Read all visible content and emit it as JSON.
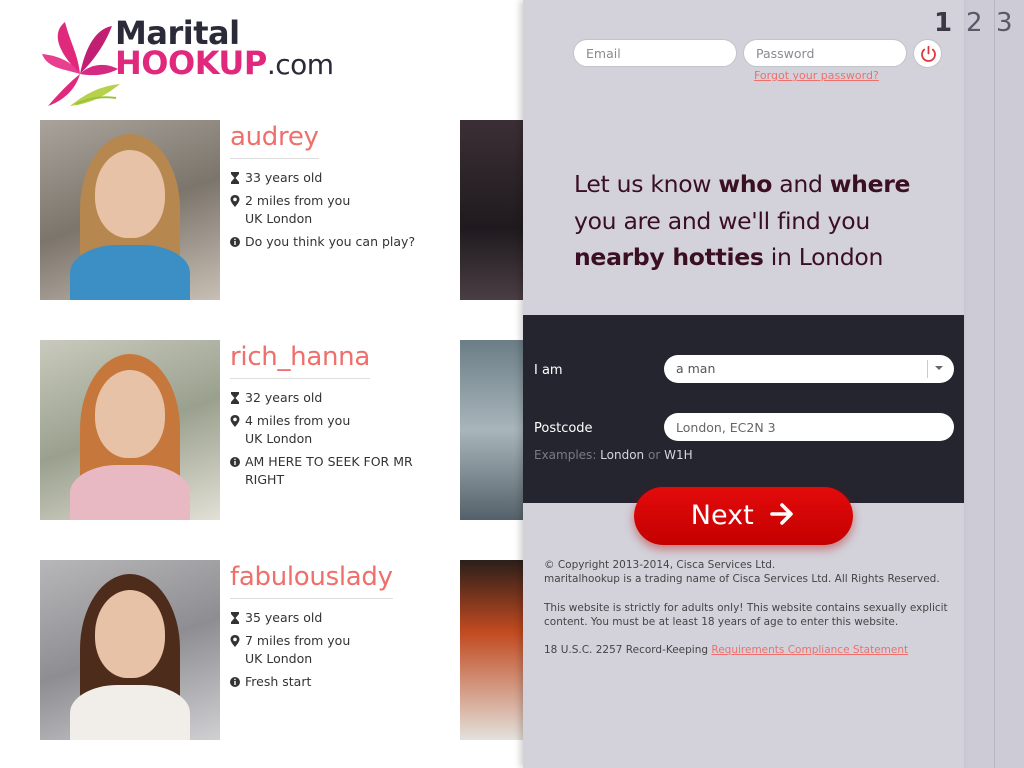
{
  "brand": {
    "line1": "Marital",
    "line2": "HOOKUP",
    "line3": ".com"
  },
  "profiles": [
    {
      "name": "audrey",
      "age": "33 years old",
      "distance": "2 miles from you",
      "location": "UK London",
      "message": "Do you think you can play?"
    },
    {
      "name": "rich_hanna",
      "age": "32 years old",
      "distance": "4 miles from you",
      "location": "UK London",
      "message": "AM HERE TO SEEK FOR MR RIGHT"
    },
    {
      "name": "fabulouslady",
      "age": "35 years old",
      "distance": "7 miles from you",
      "location": "UK London",
      "message": "Fresh start"
    }
  ],
  "steps": [
    "1",
    "2",
    "3"
  ],
  "login": {
    "email_placeholder": "Email",
    "password_placeholder": "Password",
    "forgot": "Forgot your password?"
  },
  "headline": {
    "p1": "Let us know ",
    "b1": "who",
    "p2": " and ",
    "b2": "where",
    "p3": " you are and we'll find you ",
    "b3": "nearby hotties",
    "p4": " in London"
  },
  "form": {
    "iam_label": "I am",
    "iam_value": "a man",
    "postcode_label": "Postcode",
    "postcode_value": "London, EC2N 3",
    "examples_prefix": "Examples: ",
    "example1": "London",
    "examples_or": " or ",
    "example2": "W1H"
  },
  "next_label": "Next",
  "footer": {
    "copyright": "© Copyright 2013-2014, Cisca Services Ltd.",
    "trading": "maritalhookup is a trading name of Cisca Services Ltd. All Rights Reserved.",
    "adults": "This website is strictly for adults only! This website contains sexually explicit content. You must be at least 18 years of age to enter this website.",
    "record_prefix": "18 U.S.C. 2257 Record-Keeping ",
    "record_link": "Requirements Compliance Statement"
  },
  "colors": {
    "accent": "#ef6f6c",
    "brand_pink": "#e0297d",
    "next_red": "#d60000",
    "panel": "#d3d2db",
    "form_dark": "#25252f",
    "headline": "#3a0f22"
  },
  "icons": [
    "flower-logo-icon",
    "hourglass-icon",
    "location-pin-icon",
    "info-icon",
    "power-icon",
    "chevron-down-icon",
    "arrow-right-icon"
  ]
}
